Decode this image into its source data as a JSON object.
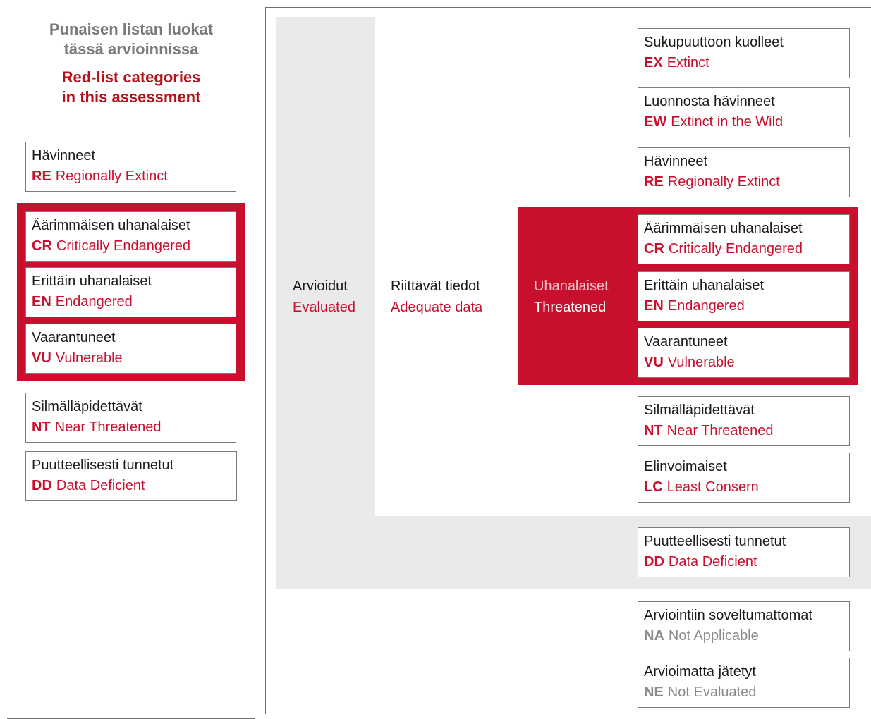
{
  "left_panel": {
    "title_fi": "Punaisen listan luokat\ntässä arvioinnissa",
    "title_en": "Red-list categories\nin this assessment",
    "categories": [
      {
        "fi": "Hävinneet",
        "code": "RE",
        "en": "Regionally Extinct"
      },
      {
        "fi": "Äärimmäisen uhanalaiset",
        "code": "CR",
        "en": "Critically Endangered"
      },
      {
        "fi": "Erittäin uhanalaiset",
        "code": "EN",
        "en": "Endangered"
      },
      {
        "fi": "Vaarantuneet",
        "code": "VU",
        "en": "Vulnerable"
      },
      {
        "fi": "Silmälläpidettävät",
        "code": "NT",
        "en": "Near Threatened"
      },
      {
        "fi": "Puutteellisesti tunnetut",
        "code": "DD",
        "en": "Data Deficient"
      }
    ]
  },
  "levels": {
    "evaluated": {
      "fi": "Arvioidut",
      "en": "Evaluated"
    },
    "adequate": {
      "fi": "Riittävät tiedot",
      "en": "Adequate data"
    },
    "threatened": {
      "fi": "Uhanalaiset",
      "en": "Threatened"
    }
  },
  "right_categories": [
    {
      "fi": "Sukupuuttoon kuolleet",
      "code": "EX",
      "en": "Extinct"
    },
    {
      "fi": "Luonnosta hävinneet",
      "code": "EW",
      "en": "Extinct in the Wild"
    },
    {
      "fi": "Hävinneet",
      "code": "RE",
      "en": "Regionally Extinct"
    },
    {
      "fi": "Äärimmäisen uhanalaiset",
      "code": "CR",
      "en": "Critically Endangered"
    },
    {
      "fi": "Erittäin uhanalaiset",
      "code": "EN",
      "en": "Endangered"
    },
    {
      "fi": "Vaarantuneet",
      "code": "VU",
      "en": "Vulnerable"
    },
    {
      "fi": "Silmälläpidettävät",
      "code": "NT",
      "en": "Near Threatened"
    },
    {
      "fi": "Elinvoimaiset",
      "code": "LC",
      "en": "Least Consern"
    },
    {
      "fi": "Puutteellisesti tunnetut",
      "code": "DD",
      "en": "Data Deficient"
    },
    {
      "fi": "Arviointiin soveltumattomat",
      "code": "NA",
      "en": "Not Applicable"
    },
    {
      "fi": "Arvioimatta jätetyt",
      "code": "NE",
      "en": "Not Evaluated"
    }
  ],
  "colors": {
    "accent_red": "#c8102e",
    "gray_fill": "#e9eaea",
    "muted_gray": "#8a8a8a"
  }
}
